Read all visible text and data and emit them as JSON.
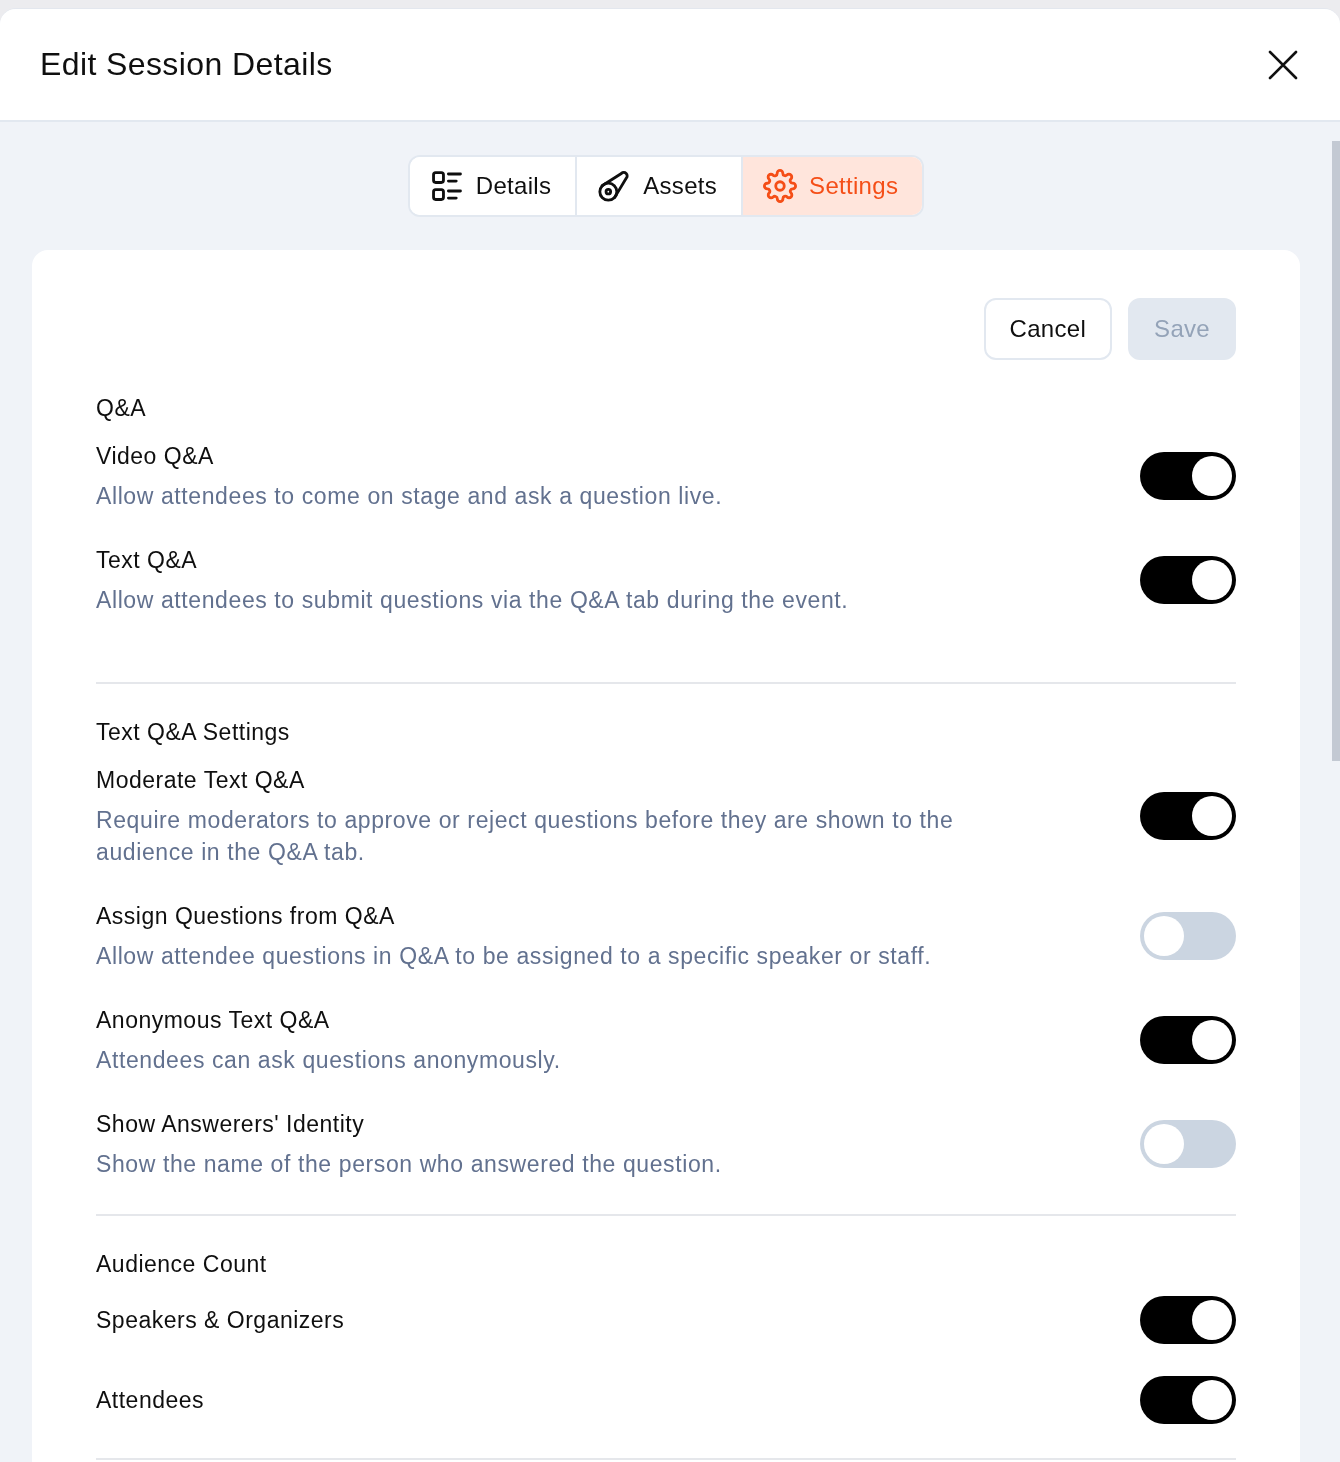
{
  "dialog": {
    "title": "Edit Session Details"
  },
  "tabs": [
    {
      "label": "Details",
      "selected": false
    },
    {
      "label": "Assets",
      "selected": false
    },
    {
      "label": "Settings",
      "selected": true
    }
  ],
  "actions": [
    {
      "label": "Cancel",
      "disabled": false
    },
    {
      "label": "Save",
      "disabled": true
    }
  ],
  "sections": [
    {
      "heading": "Q&A",
      "settings": [
        {
          "title": "Video Q&A",
          "description": "Allow attendees to come on stage and ask a question live.",
          "on": true
        },
        {
          "title": "Text Q&A",
          "description": "Allow attendees to submit questions via the Q&A tab during the event.",
          "on": true
        }
      ]
    },
    {
      "heading": "Text Q&A Settings",
      "settings": [
        {
          "title": "Moderate Text Q&A",
          "description": "Require moderators to approve or reject questions before they are shown to the audience in the Q&A tab.",
          "on": true
        },
        {
          "title": "Assign Questions from Q&A",
          "description": "Allow attendee questions in Q&A to be assigned to a specific speaker or staff.",
          "on": false
        },
        {
          "title": "Anonymous Text Q&A",
          "description": "Attendees can ask questions anonymously.",
          "on": true
        },
        {
          "title": "Show Answerers' Identity",
          "description": "Show the name of the person who answered the question.",
          "on": false
        }
      ]
    },
    {
      "heading": "Audience Count",
      "settings": [
        {
          "title": "Speakers & Organizers",
          "on": true
        },
        {
          "title": "Attendees",
          "on": true
        }
      ]
    }
  ]
}
